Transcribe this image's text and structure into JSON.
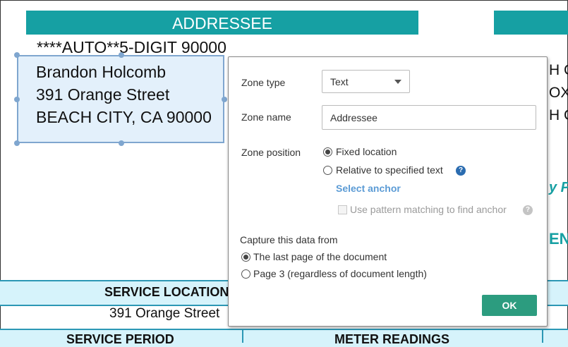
{
  "document": {
    "addressee_header": "ADDRESSEE",
    "barcode_line": "****AUTO**5-DIGIT 90000",
    "address_lines": [
      "Brandon Holcomb",
      "391 Orange Street",
      "BEACH CITY, CA 90000"
    ],
    "right_peek": [
      "H C",
      "OX",
      "H C",
      "y P",
      "EN"
    ],
    "service_location_header": "SERVICE LOCATION",
    "service_location_value": "391 Orange Street",
    "service_period_header": "SERVICE PERIOD",
    "meter_readings_header": "METER READINGS",
    "colors": {
      "header_teal": "#16a0a3",
      "zone_fill": "#e3f0fb",
      "table_fill": "#d6f3fb",
      "right_peek_text": "#16a0a3"
    }
  },
  "dialog": {
    "zone_type_label": "Zone type",
    "zone_type_value": "Text",
    "zone_name_label": "Zone name",
    "zone_name_value": "Addressee",
    "zone_position_label": "Zone position",
    "position_options": [
      "Fixed location",
      "Relative to specified text"
    ],
    "position_selected": "Fixed location",
    "select_anchor_link": "Select anchor",
    "pattern_matching_label": "Use pattern matching to find anchor",
    "capture_label": "Capture this data from",
    "capture_options": [
      "The last page of the document",
      "Page 3 (regardless of document length)"
    ],
    "capture_selected": "The last page of the document",
    "ok_label": "OK",
    "help_icon_text": "?",
    "colors": {
      "link": "#5b9bd5",
      "ok_button": "#2c9c7f",
      "help_blue": "#2b6cb0"
    }
  }
}
